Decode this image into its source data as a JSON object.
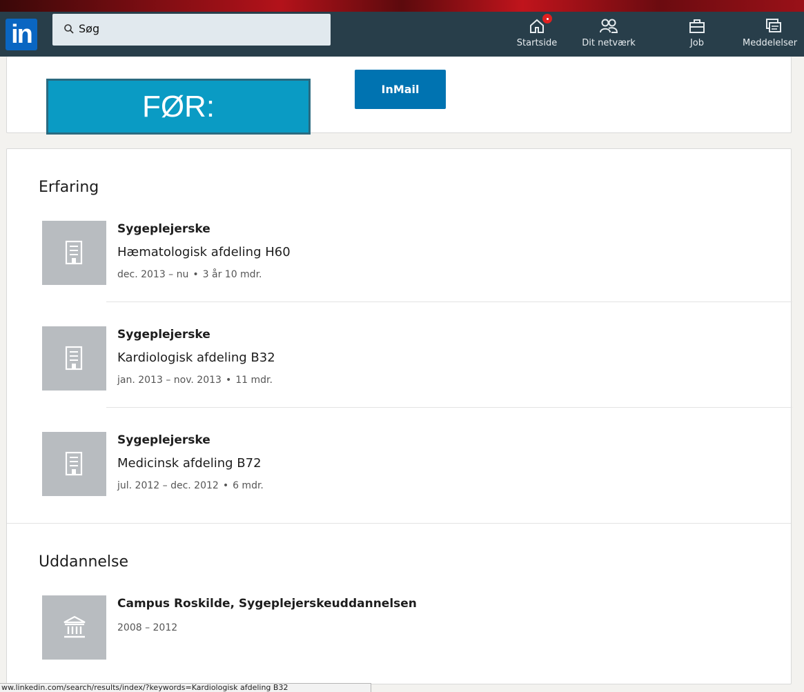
{
  "search": {
    "placeholder": "Søg"
  },
  "nav": {
    "logo_text": "in",
    "items": [
      {
        "label": "Startside",
        "icon": "home-icon",
        "has_badge": true
      },
      {
        "label": "Dit netværk",
        "icon": "network-icon"
      },
      {
        "label": "Job",
        "icon": "briefcase-icon"
      },
      {
        "label": "Meddelelser",
        "icon": "messages-icon"
      }
    ]
  },
  "top_card": {
    "overlay_label": "FØR:",
    "inmail_label": "InMail"
  },
  "experience": {
    "title": "Erfaring",
    "entries": [
      {
        "title": "Sygeplejerske",
        "company": "Hæmatologisk afdeling H60",
        "dates": "dec. 2013 – nu",
        "duration": "3 år 10 mdr."
      },
      {
        "title": "Sygeplejerske",
        "company": "Kardiologisk afdeling B32",
        "dates": "jan. 2013 – nov. 2013",
        "duration": "11 mdr."
      },
      {
        "title": "Sygeplejerske",
        "company": "Medicinsk afdeling B72",
        "dates": "jul. 2012 – dec. 2012",
        "duration": "6 mdr."
      }
    ]
  },
  "education": {
    "title": "Uddannelse",
    "entries": [
      {
        "school": "Campus Roskilde, Sygeplejerskeuddannelsen",
        "years": "2008 – 2012"
      }
    ]
  },
  "status_bar": {
    "url": "ww.linkedin.com/search/results/index/?keywords=Kardiologisk afdeling B32"
  },
  "colors": {
    "nav_bg": "#283e4a",
    "brand": "#0a66c2",
    "button": "#0073b1",
    "overlay": "#0a9bc4",
    "badge": "#e02020"
  }
}
